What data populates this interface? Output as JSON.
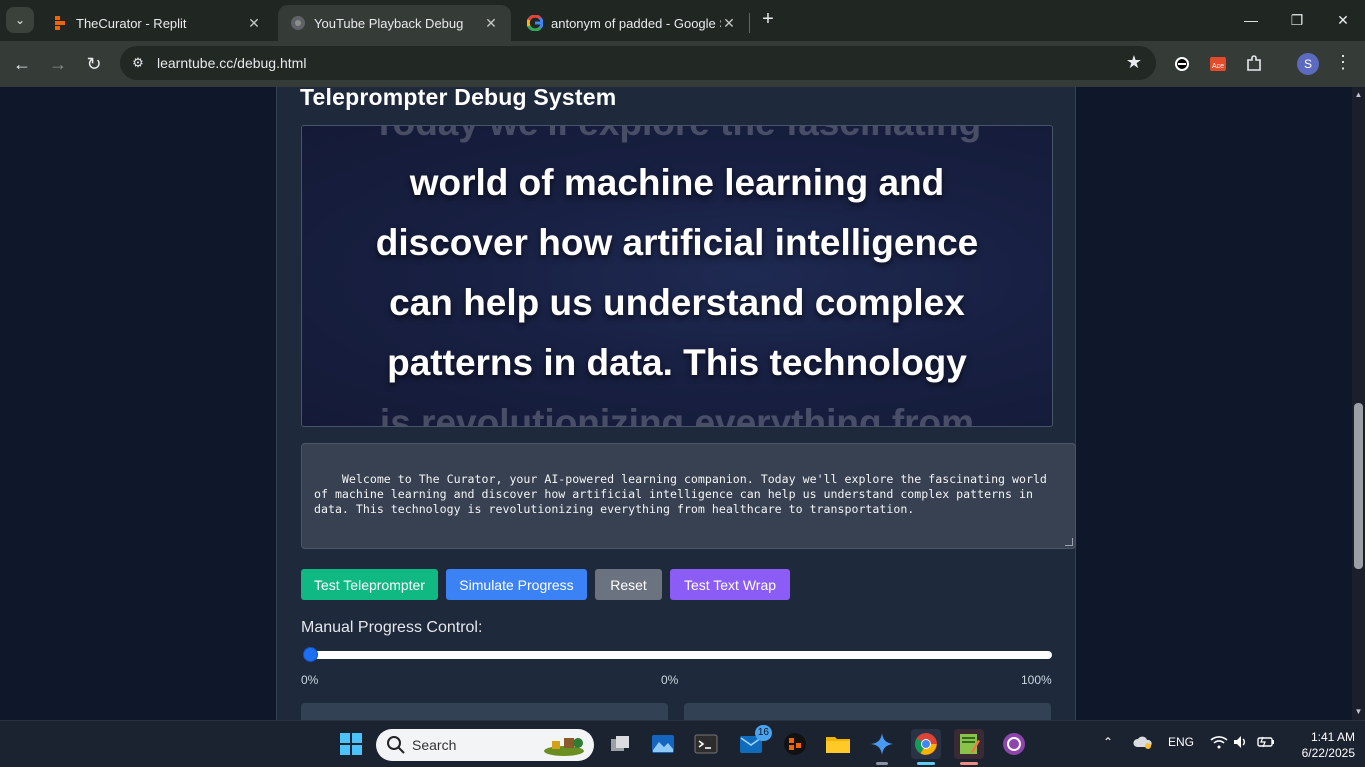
{
  "browser": {
    "tabs": [
      {
        "title": "TheCurator - Replit",
        "active": false
      },
      {
        "title": "YouTube Playback Debug",
        "active": true
      },
      {
        "title": "antonym of padded - Google S",
        "active": false
      }
    ],
    "url": "learntube.cc/debug.html",
    "profile_initial": "S"
  },
  "page": {
    "heading": "Teleprompter Debug System",
    "teleprompter": {
      "lines": [
        "Today we'll explore the fascinating",
        "world of machine learning and",
        "discover how artificial intelligence",
        "can help us understand complex",
        "patterns in data. This technology",
        "is revolutionizing everything from"
      ]
    },
    "script_text": "Welcome to The Curator, your AI-powered learning companion. Today we'll explore the fascinating world of machine learning and discover how artificial intelligence can help us understand complex patterns in data. This technology is revolutionizing everything from healthcare to transportation.",
    "buttons": {
      "test_teleprompter": "Test Teleprompter",
      "simulate_progress": "Simulate Progress",
      "reset": "Reset",
      "test_text_wrap": "Test Text Wrap"
    },
    "manual_progress": {
      "label": "Manual Progress Control:",
      "value_percent": 0,
      "min_label": "0%",
      "current_label": "0%",
      "max_label": "100%"
    },
    "colors": {
      "test_teleprompter": "#10b981",
      "simulate_progress": "#3b82f6",
      "reset": "#6b7280",
      "test_text_wrap": "#8b5cf6"
    }
  },
  "taskbar": {
    "search_placeholder": "Search",
    "mail_badge": "16",
    "tray": {
      "language": "ENG",
      "time": "1:41 AM",
      "date": "6/22/2025"
    }
  }
}
